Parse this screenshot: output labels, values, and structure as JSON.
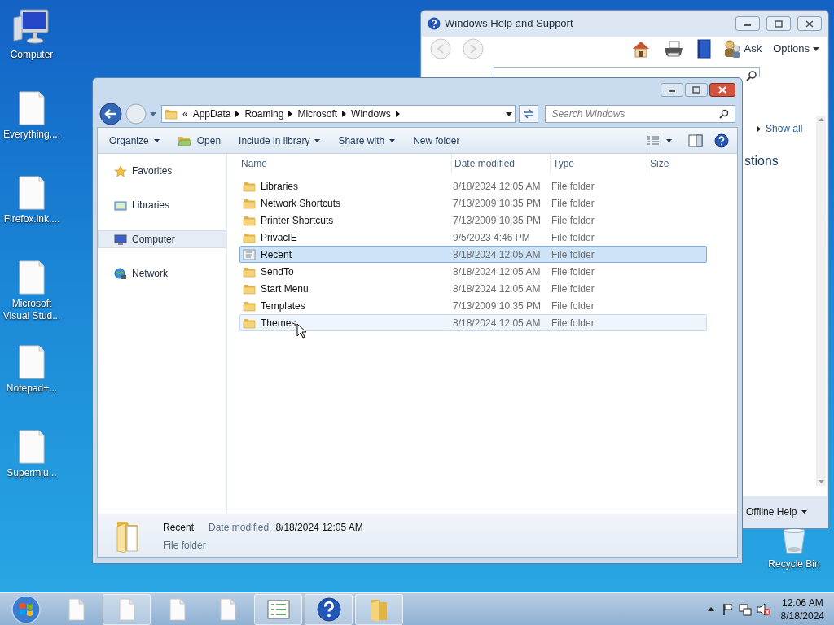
{
  "desktop_icons": [
    {
      "label": "Computer",
      "kind": "computer"
    },
    {
      "label": "Everything....",
      "kind": "file"
    },
    {
      "label": "Firefox.lnk....",
      "kind": "file"
    },
    {
      "label": "Microsoft Visual Stud...",
      "kind": "file"
    },
    {
      "label": "Notepad+...",
      "kind": "file"
    },
    {
      "label": "Supermiu...",
      "kind": "file"
    },
    {
      "label": "Recycle Bin",
      "kind": "recycle"
    }
  ],
  "help_window": {
    "title": "Windows Help and Support",
    "toolbar": [
      {
        "label": "Ask",
        "kind": "ask"
      },
      {
        "label": "Options",
        "kind": "menu"
      }
    ],
    "show_all": "Show all",
    "heading": "stions",
    "offline_help": "Offline Help"
  },
  "explorer": {
    "overflow": "«",
    "breadcrumb": [
      "AppData",
      "Roaming",
      "Microsoft",
      "Windows"
    ],
    "search": {
      "placeholder": "Search Windows"
    },
    "commands": [
      {
        "label": "Organize",
        "kind": "menu"
      },
      {
        "label": "Open",
        "kind": "open"
      },
      {
        "label": "Include in library",
        "kind": "menu"
      },
      {
        "label": "Share with",
        "kind": "menu"
      },
      {
        "label": "New folder",
        "kind": "plain"
      }
    ],
    "nav": [
      {
        "label": "Favorites",
        "kind": "star",
        "selected": false
      },
      {
        "label": "Libraries",
        "kind": "libraries",
        "selected": false
      },
      {
        "label": "Computer",
        "kind": "computer",
        "selected": true
      },
      {
        "label": "Network",
        "kind": "network",
        "selected": false
      }
    ],
    "columns": [
      "Name",
      "Date modified",
      "Type",
      "Size"
    ],
    "rows": [
      {
        "name": "Libraries",
        "date": "8/18/2024 12:05 AM",
        "type": "File folder",
        "kind": "folder",
        "selected": false,
        "hovered": false
      },
      {
        "name": "Network Shortcuts",
        "date": "7/13/2009 10:35 PM",
        "type": "File folder",
        "kind": "folder",
        "selected": false,
        "hovered": false
      },
      {
        "name": "Printer Shortcuts",
        "date": "7/13/2009 10:35 PM",
        "type": "File folder",
        "kind": "folder",
        "selected": false,
        "hovered": false
      },
      {
        "name": "PrivacIE",
        "date": "9/5/2023 4:46 PM",
        "type": "File folder",
        "kind": "folder",
        "selected": false,
        "hovered": false
      },
      {
        "name": "Recent",
        "date": "8/18/2024 12:05 AM",
        "type": "File folder",
        "kind": "special",
        "selected": true,
        "hovered": false
      },
      {
        "name": "SendTo",
        "date": "8/18/2024 12:05 AM",
        "type": "File folder",
        "kind": "folder",
        "selected": false,
        "hovered": false
      },
      {
        "name": "Start Menu",
        "date": "8/18/2024 12:05 AM",
        "type": "File folder",
        "kind": "folder",
        "selected": false,
        "hovered": false
      },
      {
        "name": "Templates",
        "date": "7/13/2009 10:35 PM",
        "type": "File folder",
        "kind": "folder",
        "selected": false,
        "hovered": false
      },
      {
        "name": "Themes",
        "date": "8/18/2024 12:05 AM",
        "type": "File folder",
        "kind": "folder",
        "selected": false,
        "hovered": true
      }
    ],
    "details": {
      "name": "Recent",
      "date_label": "Date modified:",
      "date": "8/18/2024 12:05 AM",
      "type": "File folder"
    }
  },
  "taskbar": {
    "buttons": [
      {
        "kind": "file",
        "active": false
      },
      {
        "kind": "file",
        "active": true
      },
      {
        "kind": "file",
        "active": false
      },
      {
        "kind": "file",
        "active": false
      },
      {
        "kind": "list",
        "active": true
      },
      {
        "kind": "help",
        "active": true
      },
      {
        "kind": "folder",
        "active": true
      }
    ],
    "time": "12:06 AM",
    "date": "8/18/2024"
  }
}
